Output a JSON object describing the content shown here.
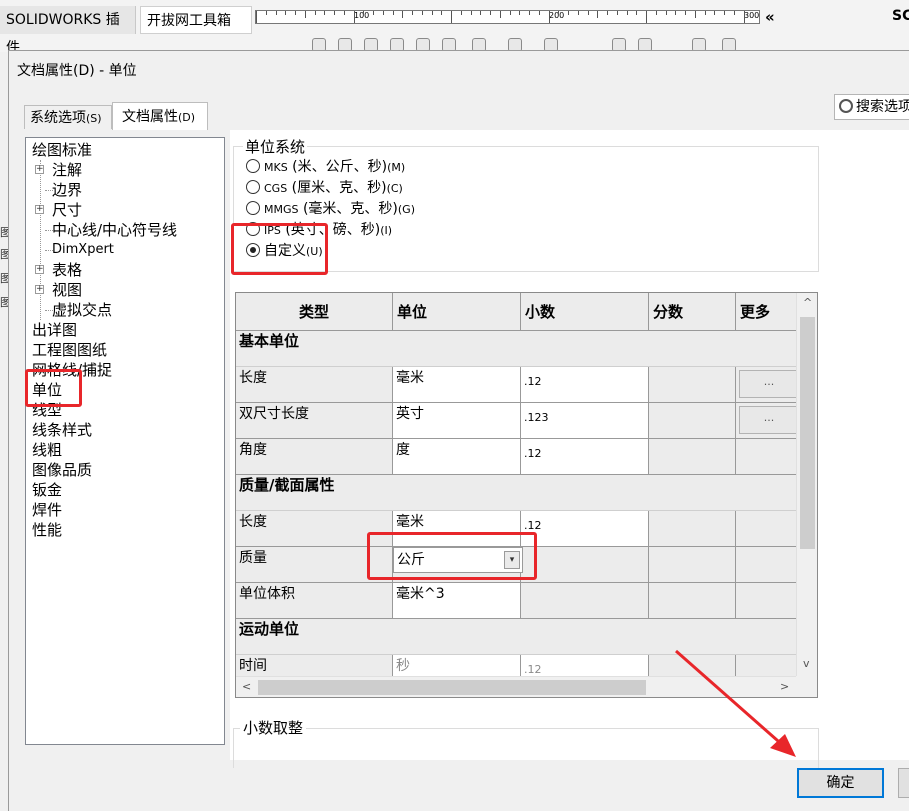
{
  "app_tabs": {
    "solidworks_plugins": "SOLIDWORKS 插件",
    "kaiba_toolbox": "开拔网工具箱"
  },
  "ruler": {
    "marks": [
      "100",
      "200",
      "300"
    ]
  },
  "top_right": {
    "collapse_glyph": "«",
    "fragment": "SC"
  },
  "bg_left_fragments": [
    "图",
    "图",
    "图",
    "图"
  ],
  "dialog": {
    "title": "文档属性(D) - 单位",
    "search_label": "搜索选项",
    "tabs": [
      {
        "label": "系统选项",
        "key": "(S)",
        "active": false
      },
      {
        "label": "文档属性",
        "key": "(D)",
        "active": true
      }
    ]
  },
  "tree": {
    "items": [
      {
        "label": "绘图标准"
      },
      {
        "label": "注解"
      },
      {
        "label": "边界"
      },
      {
        "label": "尺寸"
      },
      {
        "label": "中心线/中心符号线"
      },
      {
        "label": "DimXpert"
      },
      {
        "label": "表格"
      },
      {
        "label": "视图"
      },
      {
        "label": "虚拟交点"
      },
      {
        "label": "出详图"
      },
      {
        "label": "工程图图纸"
      },
      {
        "label": "网格线/捕捉"
      },
      {
        "label": "单位",
        "selected": true
      },
      {
        "label": "线型"
      },
      {
        "label": "线条样式"
      },
      {
        "label": "线粗"
      },
      {
        "label": "图像品质"
      },
      {
        "label": "钣金"
      },
      {
        "label": "焊件"
      },
      {
        "label": "性能"
      }
    ],
    "expand_glyph": "+"
  },
  "unit_system": {
    "group_label": "单位系统",
    "options": [
      {
        "code": "MKS",
        "label": "(米、公斤、秒)",
        "key": "(M)",
        "selected": false
      },
      {
        "code": "CGS",
        "label": "(厘米、克、秒)",
        "key": "(C)",
        "selected": false
      },
      {
        "code": "MMGS",
        "label": "(毫米、克、秒)",
        "key": "(G)",
        "selected": false
      },
      {
        "code": "IPS",
        "label": "(英寸、磅、秒)",
        "key": "(I)",
        "selected": false
      },
      {
        "code": "",
        "label": "自定义",
        "key": "(U)",
        "selected": true
      }
    ]
  },
  "units_table": {
    "headers": [
      "类型",
      "单位",
      "小数",
      "分数",
      "更多"
    ],
    "sections": [
      {
        "title": "基本单位",
        "rows": [
          {
            "type": "长度",
            "unit": "毫米",
            "decimal": ".12",
            "more": "..."
          },
          {
            "type": "双尺寸长度",
            "unit": "英寸",
            "decimal": ".123",
            "more": "..."
          },
          {
            "type": "角度",
            "unit": "度",
            "decimal": ".12",
            "more": ""
          }
        ]
      },
      {
        "title": "质量/截面属性",
        "rows": [
          {
            "type": "长度",
            "unit": "毫米",
            "decimal": ".12",
            "more": ""
          },
          {
            "type": "质量",
            "unit": "公斤",
            "decimal": "",
            "more": ""
          },
          {
            "type": "单位体积",
            "unit": "毫米^3",
            "decimal": "",
            "more": ""
          }
        ]
      },
      {
        "title": "运动单位",
        "rows": [
          {
            "type": "时间",
            "unit": "秒",
            "decimal": ".12",
            "more": ""
          }
        ]
      }
    ],
    "dropdown_glyph": "▾",
    "scroll_up": "^",
    "scroll_down": "v",
    "scroll_left": "<",
    "scroll_right": ">"
  },
  "rounding": {
    "group_label": "小数取整"
  },
  "buttons": {
    "ok": "确定"
  },
  "annotation_color": "#e8262a"
}
